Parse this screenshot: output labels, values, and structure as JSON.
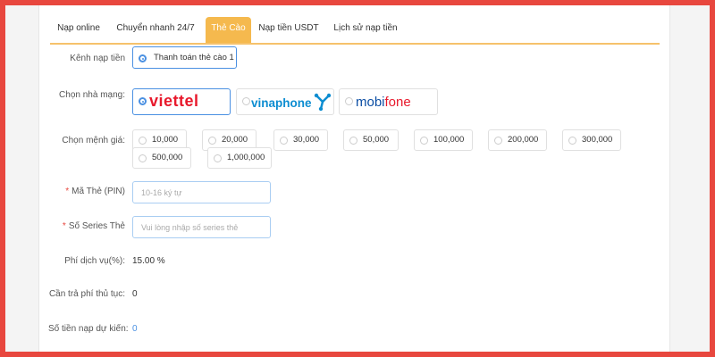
{
  "tabs": [
    {
      "label": "Nạp online"
    },
    {
      "label": "Chuyển nhanh 24/7"
    },
    {
      "label": "Thẻ Cào"
    },
    {
      "label": "Nạp tiền USDT"
    },
    {
      "label": "Lịch sử nạp tiền"
    }
  ],
  "active_tab": "Thẻ Cào",
  "channel": {
    "label": "Kênh nạp tiền",
    "option": "Thanh toán thẻ cào 1"
  },
  "operator": {
    "label": "Chọn nhà mạng:",
    "options": [
      {
        "name": "viettel",
        "selected": true,
        "color": "#e8192c"
      },
      {
        "name": "vinaphone",
        "selected": false,
        "color": "#0d8dd1"
      },
      {
        "name": "mobifone",
        "selected": false,
        "color": "#0a4da3",
        "accent": "#e8192c"
      }
    ]
  },
  "denomination": {
    "label": "Chọn mệnh giá:",
    "options": [
      "10,000",
      "20,000",
      "30,000",
      "50,000",
      "100,000",
      "200,000",
      "300,000",
      "500,000",
      "1,000,000"
    ]
  },
  "pin": {
    "label": "Mã Thẻ (PIN)",
    "placeholder": "10-16 ký tự"
  },
  "serial": {
    "label": "Số Series Thẻ",
    "placeholder": "Vui lòng nhập số series thẻ"
  },
  "fee_rate": {
    "label": "Phí dịch vụ(%):",
    "value": "15.00 %"
  },
  "fee_due": {
    "label": "Cần trả phí thủ tục:",
    "value": "0"
  },
  "expected": {
    "label": "Số tiền nạp dự kiến:",
    "value": "0"
  },
  "colors": {
    "accent_tab": "#f5b94e",
    "primary": "#4a90e2",
    "frame": "#e8473e"
  }
}
